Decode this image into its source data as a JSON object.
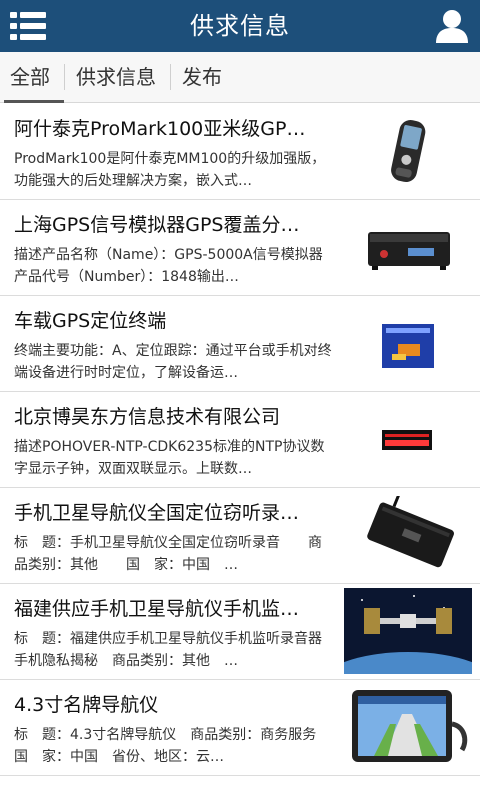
{
  "header": {
    "title": "供求信息",
    "menu_icon": "menu-list-icon",
    "user_icon": "user-icon"
  },
  "tabs": [
    {
      "label": "全部",
      "active": true
    },
    {
      "label": "供求信息",
      "active": false
    },
    {
      "label": "发布",
      "active": false
    }
  ],
  "items": [
    {
      "title": "阿什泰克ProMark100亚米级GP…",
      "desc": "ProdMark100是阿什泰克MM100的升级加强版，功能强大的后处理解决方案，嵌入式…",
      "thumb": "handheld-gps-device"
    },
    {
      "title": "上海GPS信号模拟器GPS覆盖分…",
      "desc": "描述产品名称（Name）：GPS-5000A信号模拟器产品代号（Number）：1848输出…",
      "thumb": "gps-signal-simulator-box"
    },
    {
      "title": "车载GPS定位终端",
      "desc": "终端主要功能：A、定位跟踪：通过平台或手机对终端设备进行时时定位，了解设备运…",
      "thumb": "vehicle-gps-terminal"
    },
    {
      "title": "北京博昊东方信息技术有限公司",
      "desc": "描述POHOVER-NTP-CDK6235标准的NTP协议数字显示子钟，双面双联显示。上联数…",
      "thumb": "led-clock-display"
    },
    {
      "title": "手机卫星导航仪全国定位窃听录…",
      "desc": "标　题：手机卫星导航仪全国定位窃听录音　　商品类别：其他　　国　家：中国　…",
      "thumb": "avl-tracker-device"
    },
    {
      "title": "福建供应手机卫星导航仪手机监…",
      "desc": "标　题：福建供应手机卫星导航仪手机监听录音器手机隐私揭秘　商品类别：其他　…",
      "thumb": "satellite-photo"
    },
    {
      "title": "4.3寸名牌导航仪",
      "desc": "标　题：4.3寸名牌导航仪　商品类别：商务服务　　国　家：中国　省份、地区：云…",
      "thumb": "car-navigator-screen"
    }
  ]
}
